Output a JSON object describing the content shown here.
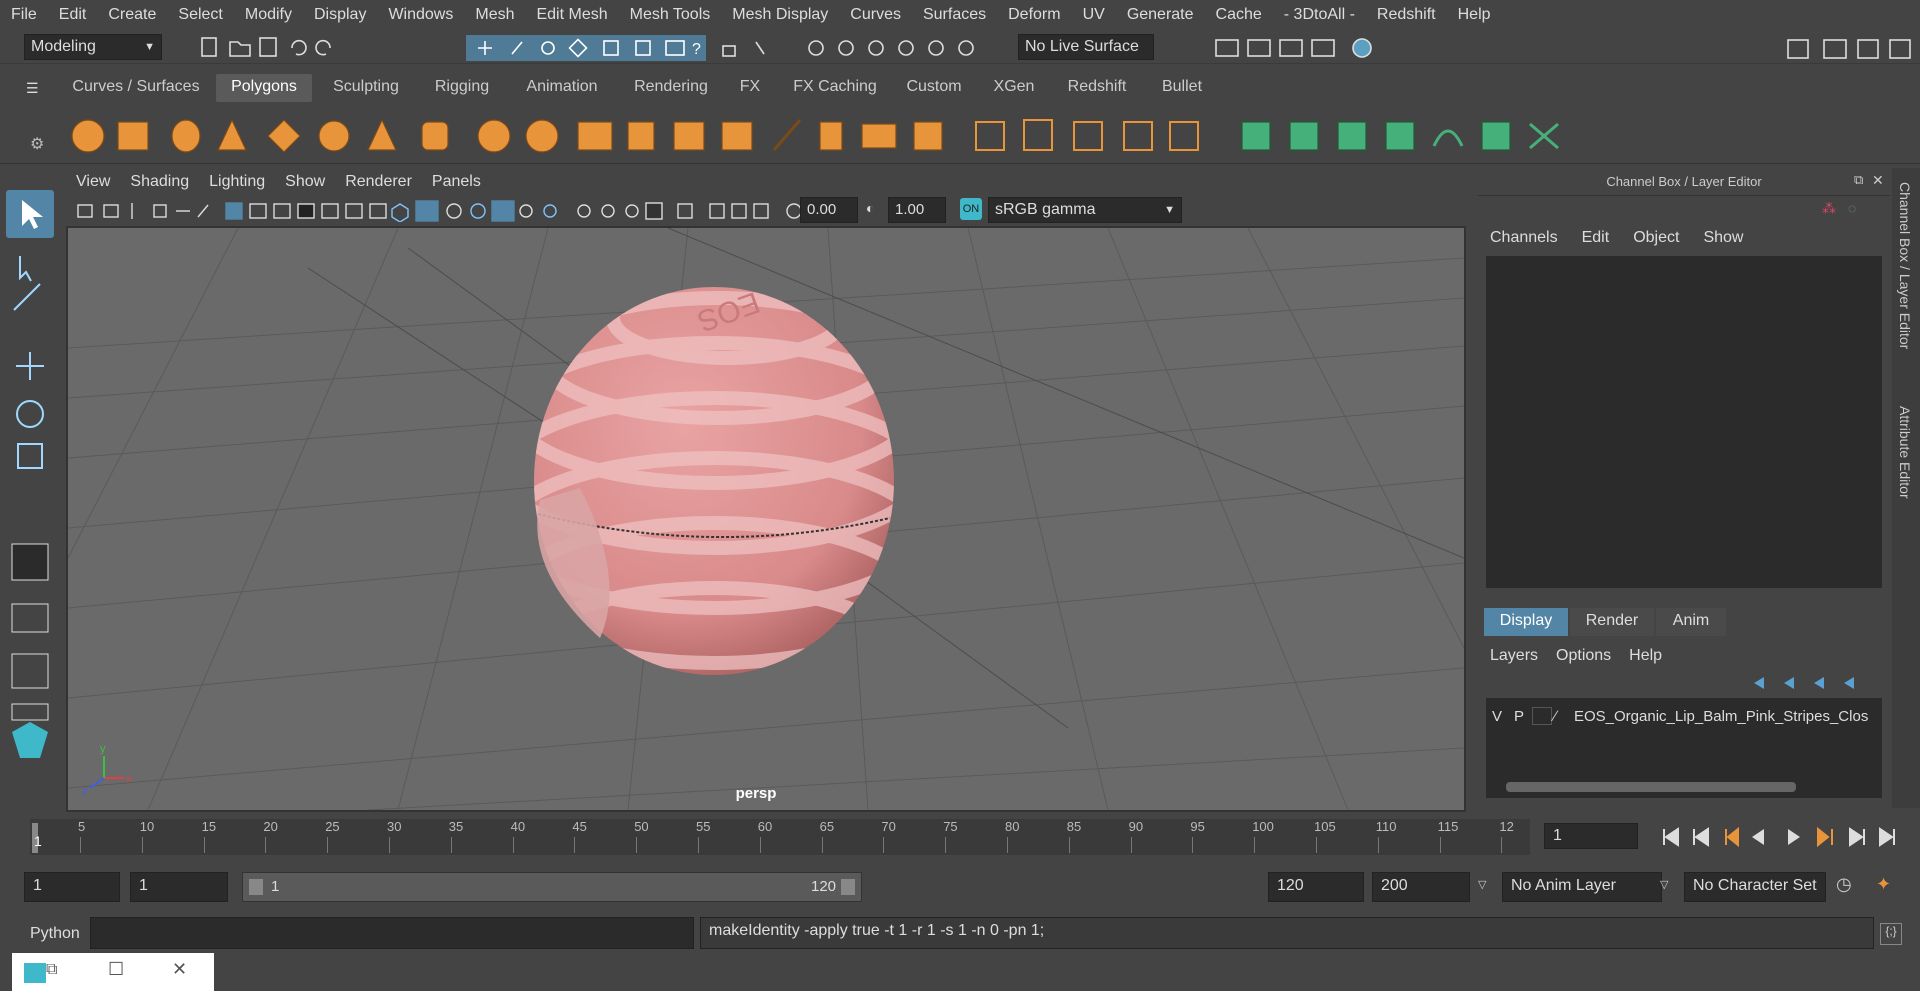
{
  "menubar": {
    "items": [
      "File",
      "Edit",
      "Create",
      "Select",
      "Modify",
      "Display",
      "Windows",
      "Mesh",
      "Edit Mesh",
      "Mesh Tools",
      "Mesh Display",
      "Curves",
      "Surfaces",
      "Deform",
      "UV",
      "Generate",
      "Cache",
      "- 3DtoAll -",
      "Redshift",
      "Help"
    ]
  },
  "status": {
    "mode": "Modeling",
    "live_surface": "No Live Surface"
  },
  "shelf_tabs": [
    "Curves / Surfaces",
    "Polygons",
    "Sculpting",
    "Rigging",
    "Animation",
    "Rendering",
    "FX",
    "FX Caching",
    "Custom",
    "XGen",
    "Redshift",
    "Bullet"
  ],
  "shelf_active_tab": "Polygons",
  "viewport": {
    "menus": [
      "View",
      "Shading",
      "Lighting",
      "Show",
      "Renderer",
      "Panels"
    ],
    "exposure": "0.00",
    "gamma": "1.00",
    "color_space": "sRGB gamma",
    "camera_label": "persp",
    "model_text": "EOS",
    "axis_x": "x",
    "axis_y": "y",
    "axis_z": "z"
  },
  "channel_box": {
    "title": "Channel Box / Layer Editor",
    "menus": [
      "Channels",
      "Edit",
      "Object",
      "Show"
    ]
  },
  "layer_editor": {
    "tabs": [
      "Display",
      "Render",
      "Anim"
    ],
    "active_tab": "Display",
    "menus": [
      "Layers",
      "Options",
      "Help"
    ],
    "layer": {
      "v": "V",
      "p": "P",
      "name": "EOS_Organic_Lip_Balm_Pink_Stripes_Clos"
    }
  },
  "side_tabs": [
    "Channel Box / Layer Editor",
    "Attribute Editor"
  ],
  "timeline": {
    "ticks": [
      "5",
      "10",
      "15",
      "20",
      "25",
      "30",
      "35",
      "40",
      "45",
      "50",
      "55",
      "60",
      "65",
      "70",
      "75",
      "80",
      "85",
      "90",
      "95",
      "100",
      "105",
      "110",
      "115",
      "12"
    ],
    "start_label": "1",
    "current_frame": "1"
  },
  "range": {
    "start": "1",
    "current": "1",
    "slider_start": "1",
    "slider_end": "120",
    "end": "120",
    "max": "200",
    "anim_layer": "No Anim Layer",
    "character_set": "No Character Set"
  },
  "command": {
    "language": "Python",
    "result": "makeIdentity -apply true -t 1 -r 1 -s 1 -n 0 -pn 1;"
  },
  "colors": {
    "accent_blue": "#5285a6",
    "shelf_orange": "#e8943a",
    "shelf_green": "#45b07a",
    "ball_pink": "#d98a8a"
  }
}
